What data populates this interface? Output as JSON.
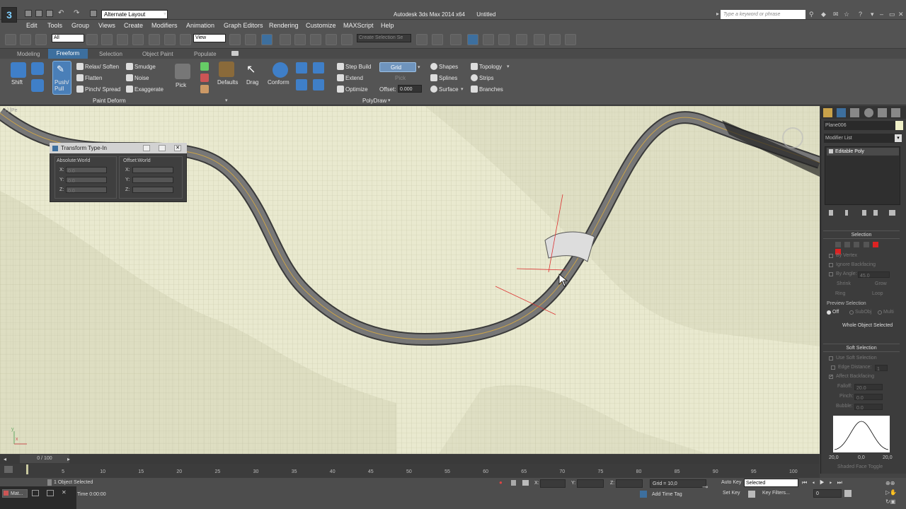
{
  "title_bar": {
    "app_title": "Autodesk 3ds Max  2014 x64",
    "doc_title": "Untitled",
    "layout": "Alternate Layout",
    "search_placeholder": "Type a keyword or phrase"
  },
  "menu": [
    "Edit",
    "Tools",
    "Group",
    "Views",
    "Create",
    "Modifiers",
    "Animation",
    "Graph Editors",
    "Rendering",
    "Customize",
    "MAXScript",
    "Help"
  ],
  "toolbar": {
    "filter": "All",
    "ref_coord": "View",
    "selection_set": "Create Selection Se"
  },
  "ribbon_tabs": [
    "Modeling",
    "Freeform",
    "Selection",
    "Object Paint",
    "Populate"
  ],
  "ribbon_active_tab": "Freeform",
  "ribbon": {
    "shift": "Shift",
    "push_pull": "Push/\nPull",
    "relax": "Relax/ Soften",
    "flatten": "Flatten",
    "pinch": "Pinch/ Spread",
    "smudge": "Smudge",
    "noise": "Noise",
    "exaggerate": "Exaggerate",
    "pick": "Pick",
    "defaults": "Defaults",
    "paint_deform": "Paint Deform",
    "drag": "Drag",
    "conform": "Conform",
    "step_build": "Step Build",
    "extend": "Extend",
    "optimize": "Optimize",
    "grid": "Grid",
    "pick_small": "Pick",
    "offset_label": "Offset:",
    "offset_value": "0.000",
    "shapes": "Shapes",
    "splines": "Splines",
    "surface": "Surface",
    "topology": "Topology",
    "strips": "Strips",
    "branches": "Branches",
    "polydraw": "PolyDraw"
  },
  "viewport": {
    "label": "+] [Pe",
    "axis_x": "x",
    "axis_y": "y"
  },
  "transform_typein": {
    "title": "Transform Type-In",
    "absolute": "Absolute:World",
    "offset": "Offset:World",
    "x": "X:",
    "y": "Y:",
    "z": "Z:",
    "abs_x": "0.0",
    "abs_y": "0.0",
    "abs_z": "0.0"
  },
  "command_panel": {
    "object_name": "Plane006",
    "modifier_list": "Modifier List",
    "stack_item": "Editable Poly",
    "selection_header": "Selection",
    "by_vertex": "By Vertex",
    "ignore_backfacing": "Ignore Backfacing",
    "by_angle": "By Angle:",
    "angle_value": "45.0",
    "shrink": "Shrink",
    "grow": "Grow",
    "ring": "Ring",
    "loop": "Loop",
    "preview_selection": "Preview Selection",
    "off": "Off",
    "subobj": "SubObj",
    "multi": "Multi",
    "whole_object": "Whole Object Selected",
    "soft_selection_header": "Soft Selection",
    "use_soft_selection": "Use Soft Selection",
    "edge_distance": "Edge Distance:",
    "edge_distance_value": "1",
    "affect_backfacing": "Affect Backfacing",
    "falloff": "Falloff:",
    "falloff_value": "20.0",
    "pinch": "Pinch:",
    "pinch_value": "0.0",
    "bubble": "Bubble:",
    "bubble_value": "0.0",
    "curve_left": "20,0",
    "curve_mid": "0,0",
    "curve_right": "20,0",
    "shaded_face_toggle": "Shaded Face Toggle"
  },
  "timeline": {
    "frame": "0 / 100",
    "ticks": [
      "0",
      "5",
      "10",
      "15",
      "20",
      "25",
      "30",
      "35",
      "40",
      "45",
      "50",
      "55",
      "60",
      "65",
      "70",
      "75",
      "80",
      "85",
      "90",
      "95",
      "100"
    ]
  },
  "status": {
    "objects_selected": "1 Object Selected",
    "time": "Time  0:00:00",
    "x_label": "X:",
    "y_label": "Y:",
    "z_label": "Z:",
    "grid": "Grid = 10,0",
    "add_time_tag": "Add Time Tag",
    "auto_key": "Auto Key",
    "set_key": "Set Key",
    "key_mode": "Selected",
    "key_filters": "Key Filters...",
    "frame_field": "0"
  },
  "taskbar_label": "Mat..."
}
